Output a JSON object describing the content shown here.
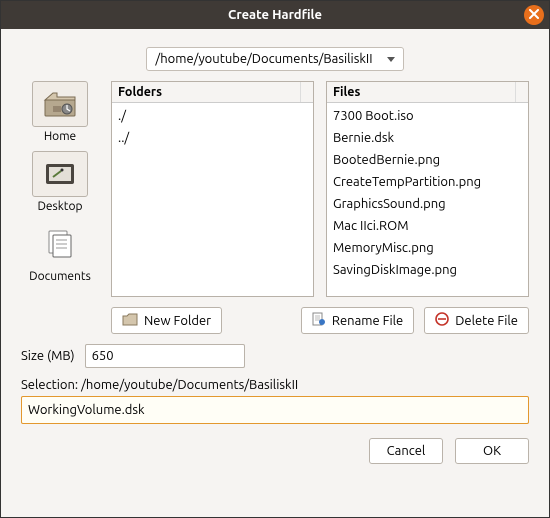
{
  "title": "Create Hardfile",
  "path": "/home/youtube/Documents/BasiliskII",
  "side": {
    "home": "Home",
    "desktop": "Desktop",
    "documents": "Documents"
  },
  "panels": {
    "folders_header": "Folders",
    "files_header": "Files",
    "folders": [
      "./",
      "../"
    ],
    "files": [
      "7300 Boot.iso",
      "Bernie.dsk",
      "BootedBernie.png",
      "CreateTempPartition.png",
      "GraphicsSound.png",
      "Mac IIci.ROM",
      "MemoryMisc.png",
      "SavingDiskImage.png"
    ]
  },
  "buttons": {
    "new_folder": "New Folder",
    "rename_file": "Rename File",
    "delete_file": "Delete File",
    "cancel": "Cancel",
    "ok": "OK"
  },
  "size": {
    "label": "Size (MB)",
    "value": "650"
  },
  "selection": {
    "label": "Selection: /home/youtube/Documents/BasiliskII",
    "value": "WorkingVolume.dsk"
  }
}
